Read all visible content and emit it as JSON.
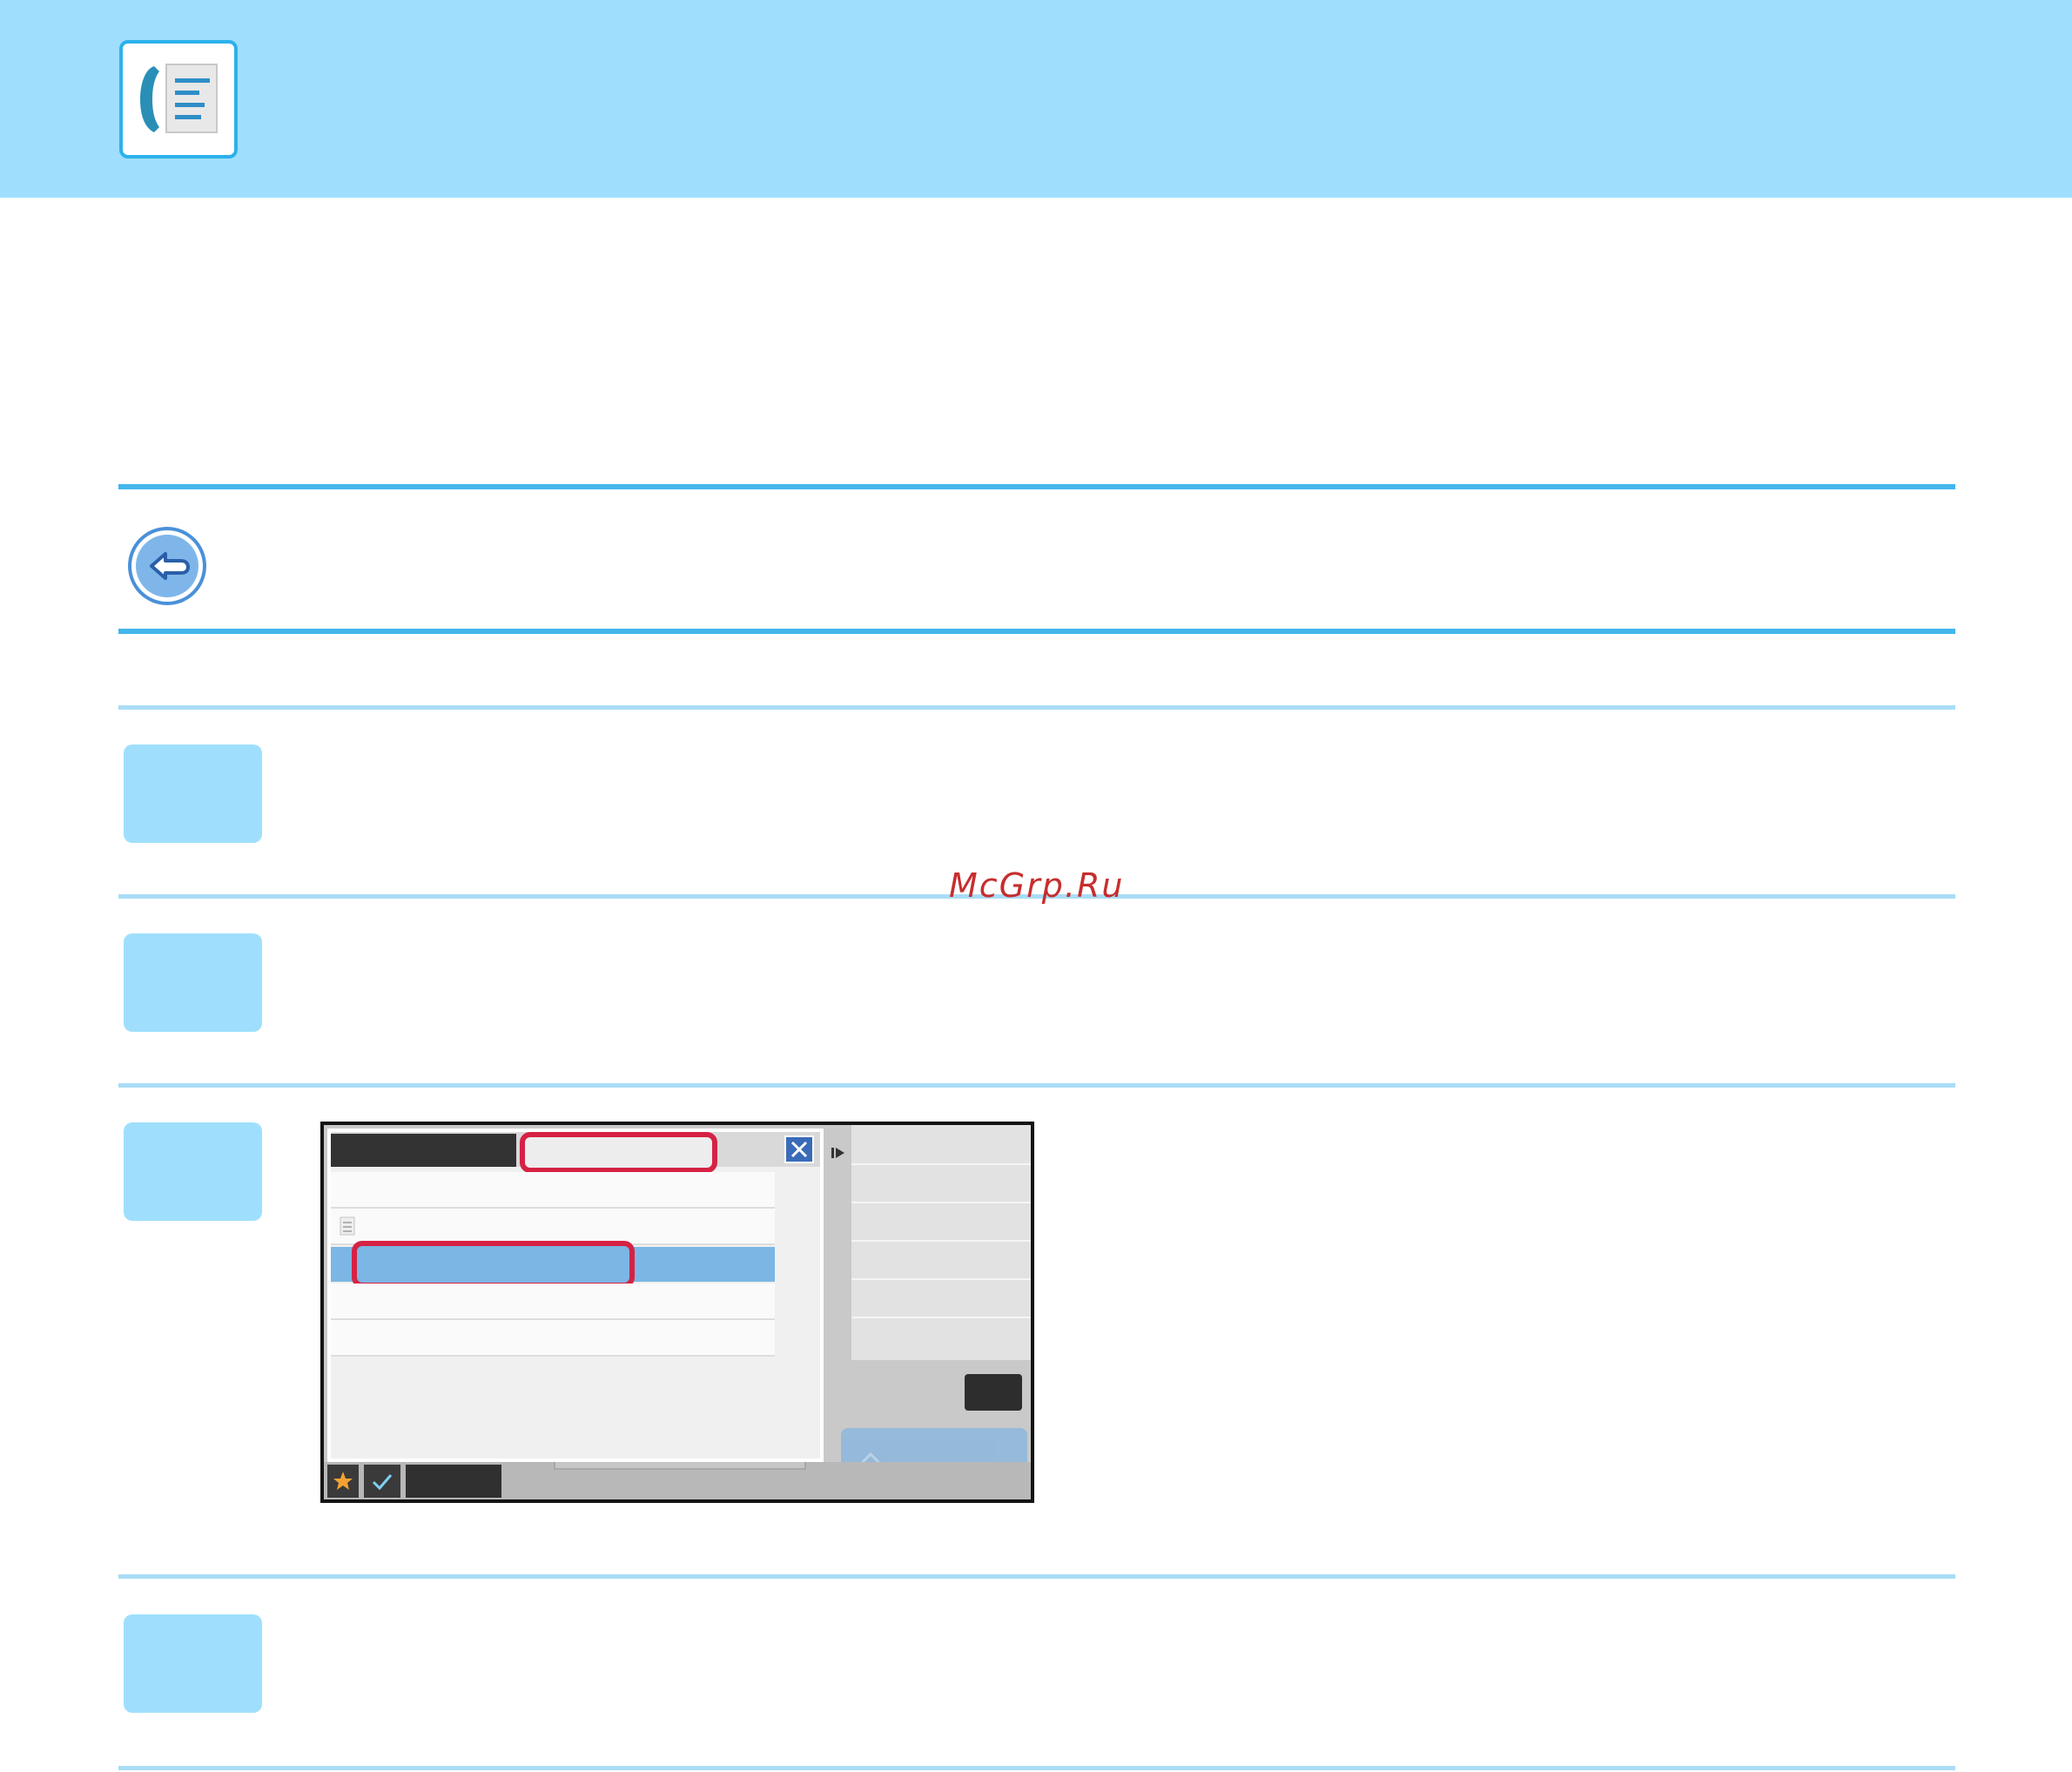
{
  "header": {
    "icon": "fax-address-book-icon",
    "brand_color": "#9fdffd",
    "accent_color": "#43b6ec"
  },
  "nav": {
    "back_icon": "back-arrow-icon"
  },
  "steps": [
    {
      "badge_label": "",
      "text": ""
    },
    {
      "badge_label": "",
      "text": ""
    },
    {
      "badge_label": "",
      "text": ""
    },
    {
      "badge_label": "",
      "text": ""
    }
  ],
  "watermark": {
    "text": "McGrp.Ru",
    "color": "#c72d2d"
  },
  "screen": {
    "highlight_color": "#d52244",
    "selected_row_color": "#7cb6e4",
    "icons": [
      "close-icon",
      "star-icon",
      "check-icon",
      "play-next-icon",
      "list-icon",
      "start-icon"
    ]
  }
}
